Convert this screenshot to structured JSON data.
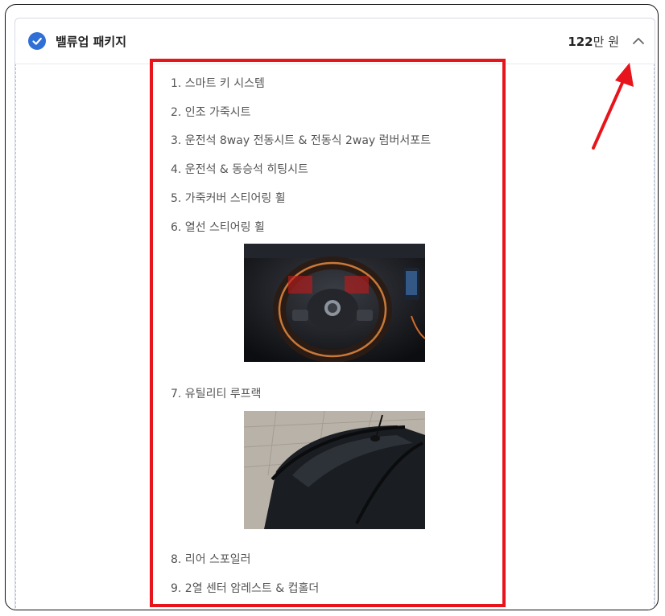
{
  "package": {
    "title": "밸류업 패키지",
    "price_number": "122",
    "price_unit": "만 원",
    "checked": true,
    "expanded": true
  },
  "features": [
    "1. 스마트 키 시스템",
    "2. 인조 가죽시트",
    "3. 운전석 8way 전동시트 & 전동식 2way 럼버서포트",
    "4. 운전석 & 동승석 히팅시트",
    "5. 가죽커버 스티어링 휠",
    "6. 열선 스티어링 휠",
    "7. 유틸리티 루프랙",
    "8. 리어 스포일러",
    "9. 2열 센터 암레스트 & 컵홀더"
  ],
  "images": [
    {
      "name": "steering-wheel-photo",
      "depicts": "heated leather steering wheel"
    },
    {
      "name": "roof-rack-photo",
      "depicts": "utility roof rack on car roof"
    }
  ],
  "icons": {
    "check": "check-circle-icon",
    "collapse": "chevron-up-icon"
  },
  "colors": {
    "accent_blue": "#2f6fd6",
    "highlight_red": "#e8141b",
    "text": "#555555"
  }
}
